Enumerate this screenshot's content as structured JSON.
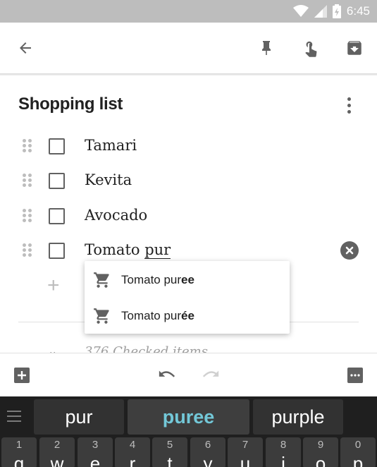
{
  "status_bar": {
    "time": "6:45"
  },
  "toolbar": {
    "back_icon": "arrow-back-icon",
    "pin_icon": "pin-icon",
    "reminder_icon": "reminder-hand-icon",
    "archive_icon": "archive-icon"
  },
  "note": {
    "title": "Shopping list",
    "items": [
      {
        "text": "Tamari",
        "checked": false
      },
      {
        "text": "Kevita",
        "checked": false
      },
      {
        "text": "Avocado",
        "checked": false
      },
      {
        "text_prefix": "Tomato ",
        "text_composing": "pur",
        "checked": false
      }
    ],
    "checked_label": "376 Checked items"
  },
  "autocomplete": {
    "items": [
      {
        "normal": "Tomato pur",
        "bold": "ee"
      },
      {
        "normal": "Tomato pur",
        "bold": "ée"
      }
    ]
  },
  "bottom_bar": {
    "add_icon": "add-box-icon",
    "undo_icon": "undo-icon",
    "redo_icon": "redo-icon",
    "more_icon": "more-horiz-icon"
  },
  "keyboard": {
    "suggestions": [
      "pur",
      "puree",
      "purple"
    ],
    "keys": [
      {
        "num": "1",
        "letter": "q"
      },
      {
        "num": "2",
        "letter": "w"
      },
      {
        "num": "3",
        "letter": "e"
      },
      {
        "num": "4",
        "letter": "r"
      },
      {
        "num": "5",
        "letter": "t"
      },
      {
        "num": "6",
        "letter": "y"
      },
      {
        "num": "7",
        "letter": "u"
      },
      {
        "num": "8",
        "letter": "i"
      },
      {
        "num": "9",
        "letter": "o"
      },
      {
        "num": "0",
        "letter": "p"
      }
    ]
  },
  "colors": {
    "status_bar": "#bdbdbd",
    "icon_gray": "#616161",
    "suggestion_accent": "#73c8d8",
    "keyboard_bg": "#1f1f1f"
  }
}
